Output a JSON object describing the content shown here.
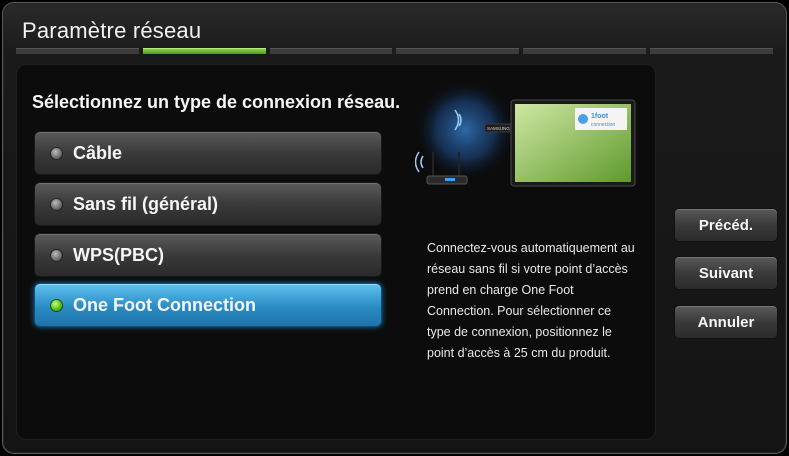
{
  "window": {
    "title": "Paramètre réseau"
  },
  "steps": {
    "count": 6,
    "active_index": 1
  },
  "prompt": "Sélectionnez un type de connexion réseau.",
  "options": [
    {
      "label": "Câble",
      "selected": false
    },
    {
      "label": "Sans fil (général)",
      "selected": false
    },
    {
      "label": "WPS(PBC)",
      "selected": false
    },
    {
      "label": "One Foot Connection",
      "selected": true
    }
  ],
  "illustration": {
    "tv_brand": "SAMSUNG",
    "screen_logo_line1": "1foot",
    "screen_logo_line2": "connection"
  },
  "description": "Connectez-vous automatiquement au réseau sans fil si votre point d’accès prend en charge One Foot Connection. Pour sélectionner ce type de connexion, positionnez le point d’accès à 25 cm du produit.",
  "buttons": {
    "prev": "Précéd.",
    "next": "Suivant",
    "cancel": "Annuler"
  },
  "colors": {
    "accent_green": "#6cc23a",
    "selected_blue": "#2a8cc4"
  }
}
